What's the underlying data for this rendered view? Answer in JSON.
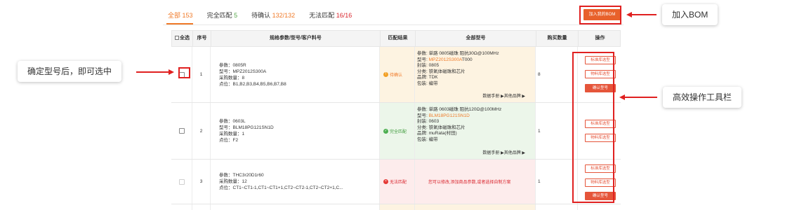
{
  "tabs": [
    {
      "label": "全部",
      "count": "153"
    },
    {
      "label": "完全匹配",
      "count": "5"
    },
    {
      "label": "待确认",
      "count": "132/132"
    },
    {
      "label": "无法匹配",
      "count": "16/16"
    }
  ],
  "add_bom_button": "加入我的BOM",
  "header": {
    "select_all": "全选",
    "index": "序号",
    "spec": "规格参数/型号/客户料号",
    "match": "匹配结果",
    "models": "全部型号",
    "qty": "购买数量",
    "ops": "操作"
  },
  "rows": [
    {
      "index": "1",
      "spec": [
        "参数：0805R",
        "型号：MPZ2012S300A",
        "采购数量：8",
        "点位：B1,B2,B3,B4,B5,B6,B7,B8"
      ],
      "match": "待确认",
      "models": [
        "参数: 单路 0805磁珠 阻抗30Ω@100MHz",
        "型号: ",
        "封装: 0805",
        "分类: 铁氧体磁珠和芯片",
        "品牌: TDK",
        "包装: 编带"
      ],
      "model_hl": "MPZ2012S300A",
      "model_suffix": "T000",
      "manual": "数据手册 ▶其他品牌 ▶",
      "qty": "8",
      "ops": [
        "标准库选型",
        "物料库选型",
        "确认型号"
      ]
    },
    {
      "index": "2",
      "spec": [
        "参数：0603L",
        "型号：BLM18PG121SN1D",
        "采购数量：1",
        "点位：F2"
      ],
      "match": "完全匹配",
      "models": [
        "参数: 单路 0603磁珠 阻抗120Ω@100MHz",
        "型号: ",
        "封装: 0603",
        "分类: 铁氧体磁珠和芯片",
        "品牌: muRata(村田)",
        "包装: 编带"
      ],
      "model_hl": "BLM18PG121SN1D",
      "manual": "数据手册 ▶其他品牌 ▶",
      "qty": "1",
      "ops": [
        "标准库选型",
        "物料库选型"
      ]
    },
    {
      "index": "3",
      "spec": [
        "参数：THC3r20D1r60",
        "采购数量：12",
        "点位：CT1~CT1-1,CT1~CT1+1,CT2~CT2-1,CT2~CT2+1,C..."
      ],
      "match": "无法匹配",
      "fail_message": "您可以修改,添加商品参数,或者选择自制方案",
      "qty": "1",
      "ops": [
        "标准库选型",
        "物料库选型",
        "确认型号"
      ]
    }
  ],
  "callouts": {
    "checkbox": "确定型号后，即可选中",
    "bom": "加入BOM",
    "toolbar": "高效操作工具栏"
  }
}
